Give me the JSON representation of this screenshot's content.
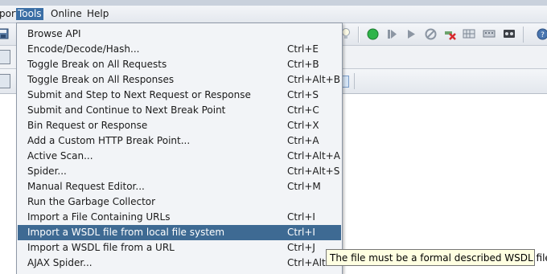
{
  "menubar": {
    "items": [
      {
        "label": "port"
      },
      {
        "label": "Tools",
        "active": true
      },
      {
        "label": "Online"
      },
      {
        "label": "Help"
      }
    ]
  },
  "toolbar_icons": [
    "save-icon",
    "lightbulb-icon",
    "start-green-icon",
    "step-icon",
    "play-icon",
    "stop-circle-icon",
    "crossed-tool-icon",
    "grid-icon",
    "keyboard-icon",
    "tape-icon",
    "help-icon"
  ],
  "tools_menu": {
    "items": [
      {
        "label": "Browse API",
        "shortcut": ""
      },
      {
        "label": "Encode/Decode/Hash...",
        "shortcut": "Ctrl+E"
      },
      {
        "label": "Toggle Break on All Requests",
        "shortcut": "Ctrl+B"
      },
      {
        "label": "Toggle Break on All Responses",
        "shortcut": "Ctrl+Alt+B"
      },
      {
        "label": "Submit and Step to Next Request or Response",
        "shortcut": "Ctrl+S"
      },
      {
        "label": "Submit and Continue to Next Break Point",
        "shortcut": "Ctrl+C"
      },
      {
        "label": "Bin Request or Response",
        "shortcut": "Ctrl+X"
      },
      {
        "label": "Add a Custom HTTP Break Point...",
        "shortcut": "Ctrl+A"
      },
      {
        "label": "Active Scan...",
        "shortcut": "Ctrl+Alt+A"
      },
      {
        "label": "Spider...",
        "shortcut": "Ctrl+Alt+S"
      },
      {
        "label": "Manual Request Editor...",
        "shortcut": "Ctrl+M"
      },
      {
        "label": "Run the Garbage Collector",
        "shortcut": ""
      },
      {
        "label": "Import a File Containing URLs",
        "shortcut": "Ctrl+I"
      },
      {
        "label": "Import a WSDL file from local file system",
        "shortcut": "Ctrl+I",
        "selected": true
      },
      {
        "label": "Import a WSDL file from a URL",
        "shortcut": "Ctrl+J"
      },
      {
        "label": "AJAX Spider...",
        "shortcut": "Ctrl+Alt+X"
      }
    ]
  },
  "tooltip": {
    "text": "The file must be a formal described WSDL file."
  },
  "colors": {
    "selection": "#3e6a93",
    "menu_bg": "#f2f4f7",
    "tooltip_bg": "#ffffe1"
  }
}
